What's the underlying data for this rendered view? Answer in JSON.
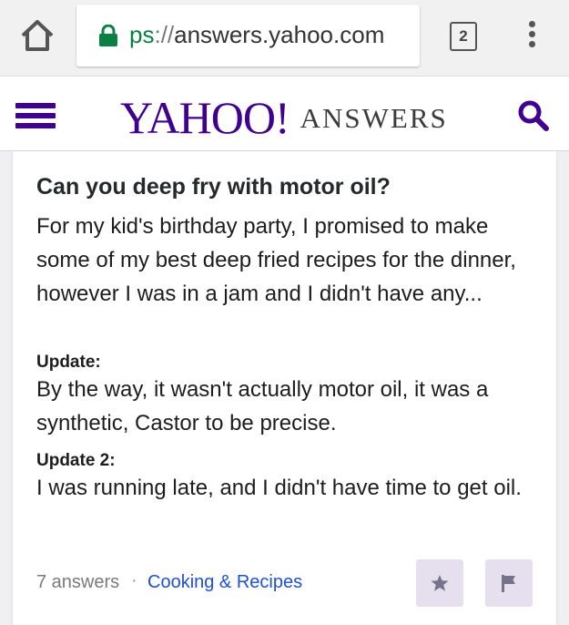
{
  "browser": {
    "url_scheme": "ps",
    "url_separator": "://",
    "url_host": "answers.yahoo.com",
    "tab_count": "2",
    "icons": [
      "home-icon",
      "lock-icon",
      "tabs-icon",
      "overflow-menu-icon"
    ]
  },
  "header": {
    "logo_main": "YAHOO!",
    "logo_sub": "ANSWERS",
    "brand_color": "#400090",
    "icons": [
      "hamburger-menu-icon",
      "search-icon"
    ]
  },
  "question": {
    "title": "Can you deep fry with motor oil?",
    "body": "For my kid's birthday party, I promised to make some of my best deep fried recipes for the dinner, however I was in a jam and I didn't have any...",
    "updates": [
      {
        "label": "Update:",
        "text": "By the way, it wasn't actually motor oil, it was a synthetic, Castor to be precise."
      },
      {
        "label": "Update 2:",
        "text": "I was running late, and I didn't have time to get oil."
      }
    ]
  },
  "footer": {
    "answers_count": "7 answers",
    "separator": "·",
    "category": "Cooking & Recipes",
    "category_color": "#1e50d2",
    "icons": [
      "star-icon",
      "flag-icon"
    ]
  }
}
